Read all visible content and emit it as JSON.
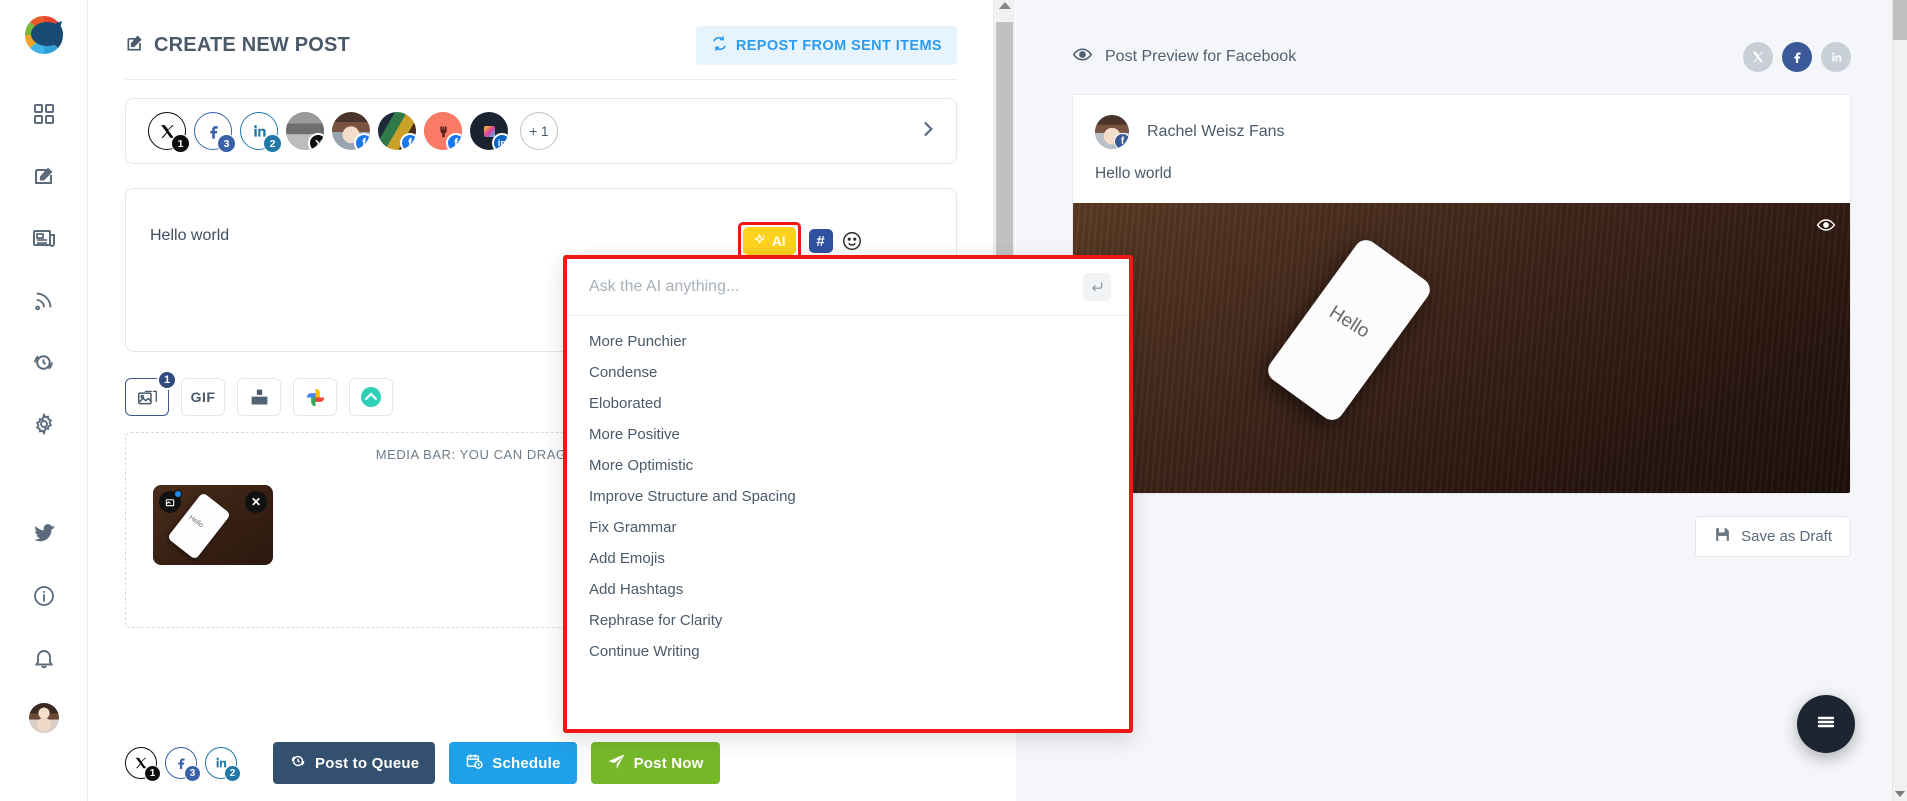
{
  "sidebar": {
    "logo_name": "app-logo",
    "items": [
      {
        "icon": "dashboard-icon",
        "name": "sidebar-item-dashboard"
      },
      {
        "icon": "compose-icon",
        "name": "sidebar-item-compose"
      },
      {
        "icon": "feed-icon",
        "name": "sidebar-item-content"
      },
      {
        "icon": "rss-icon",
        "name": "sidebar-item-rss"
      },
      {
        "icon": "queue-icon",
        "name": "sidebar-item-queue"
      },
      {
        "icon": "gear-icon",
        "name": "sidebar-item-settings"
      },
      {
        "icon": "twitter-icon",
        "name": "sidebar-item-twitter"
      },
      {
        "icon": "info-icon",
        "name": "sidebar-item-info"
      },
      {
        "icon": "bell-icon",
        "name": "sidebar-item-notifications"
      }
    ]
  },
  "composer": {
    "title": "CREATE NEW POST",
    "repost_label": "REPOST FROM SENT ITEMS",
    "accounts": [
      {
        "network": "x",
        "type": "outline",
        "badge": "1",
        "badge_kind": "x"
      },
      {
        "network": "facebook",
        "type": "outline",
        "badge": "3",
        "badge_kind": "fb"
      },
      {
        "network": "linkedin",
        "type": "outline",
        "badge": "2",
        "badge_kind": "li"
      },
      {
        "network": "x",
        "type": "photo-bw",
        "badge_kind": "x"
      },
      {
        "network": "facebook",
        "type": "photo-woman",
        "badge_kind": "fb"
      },
      {
        "network": "facebook",
        "type": "photo-sports",
        "badge_kind": "fb"
      },
      {
        "network": "facebook",
        "type": "photo-coral",
        "badge_kind": "fb"
      },
      {
        "network": "linkedin",
        "type": "photo-dark",
        "badge_kind": "li"
      }
    ],
    "more_accounts_label": "+ 1",
    "editor_text": "Hello world",
    "ai_button_label": "AI",
    "hash_button_label": "#",
    "media_buttons": [
      {
        "name": "media-image-button",
        "label": "",
        "count": "1",
        "active": true
      },
      {
        "name": "media-gif-button",
        "label": "GIF",
        "active": false
      },
      {
        "name": "media-upload-button",
        "label": "",
        "active": false
      },
      {
        "name": "media-google-photos-button",
        "label": "",
        "active": false
      },
      {
        "name": "media-cloud-button",
        "label": "",
        "active": false
      }
    ],
    "dropzone_text": "MEDIA BAR: YOU CAN DRAG-N-DROP IMAGE, GIF",
    "thumbnail_alt": "phone-on-wood-photo"
  },
  "ai_panel": {
    "input_placeholder": "Ask the AI anything...",
    "input_value": "",
    "submit_icon": "enter-arrow-icon",
    "options": [
      "More Punchier",
      "Condense",
      "Eloborated",
      "More Positive",
      "More Optimistic",
      "Improve Structure and Spacing",
      "Fix Grammar",
      "Add Emojis",
      "Add Hashtags",
      "Rephrase for Clarity",
      "Continue Writing"
    ],
    "highlight_color": "#f01717"
  },
  "actions": {
    "accounts": [
      {
        "network": "x",
        "badge": "1",
        "badge_kind": "x"
      },
      {
        "network": "facebook",
        "badge": "3",
        "badge_kind": "fb"
      },
      {
        "network": "linkedin",
        "badge": "2",
        "badge_kind": "li"
      }
    ],
    "post_to_queue": "Post to Queue",
    "schedule": "Schedule",
    "post_now": "Post Now"
  },
  "preview": {
    "title": "Post Preview for Facebook",
    "networks": [
      {
        "name": "preview-network-x",
        "label": "X",
        "state": "off"
      },
      {
        "name": "preview-network-facebook",
        "label": "f",
        "state": "on"
      },
      {
        "name": "preview-network-linkedin",
        "label": "in",
        "state": "off"
      }
    ],
    "author_name": "Rachel Weisz Fans",
    "post_text": "Hello world",
    "image_alt": "phone-on-wood-photo",
    "save_draft_label": "Save as Draft"
  },
  "fab": {
    "name": "menu-fab",
    "icon": "hamburger-icon"
  },
  "colors": {
    "ai_yellow": "#FFD21E",
    "highlight_red": "#f01717",
    "queue_navy": "#34506f",
    "schedule_blue": "#20a0e8",
    "post_green": "#76b82a",
    "facebook_blue": "#3b5998"
  }
}
